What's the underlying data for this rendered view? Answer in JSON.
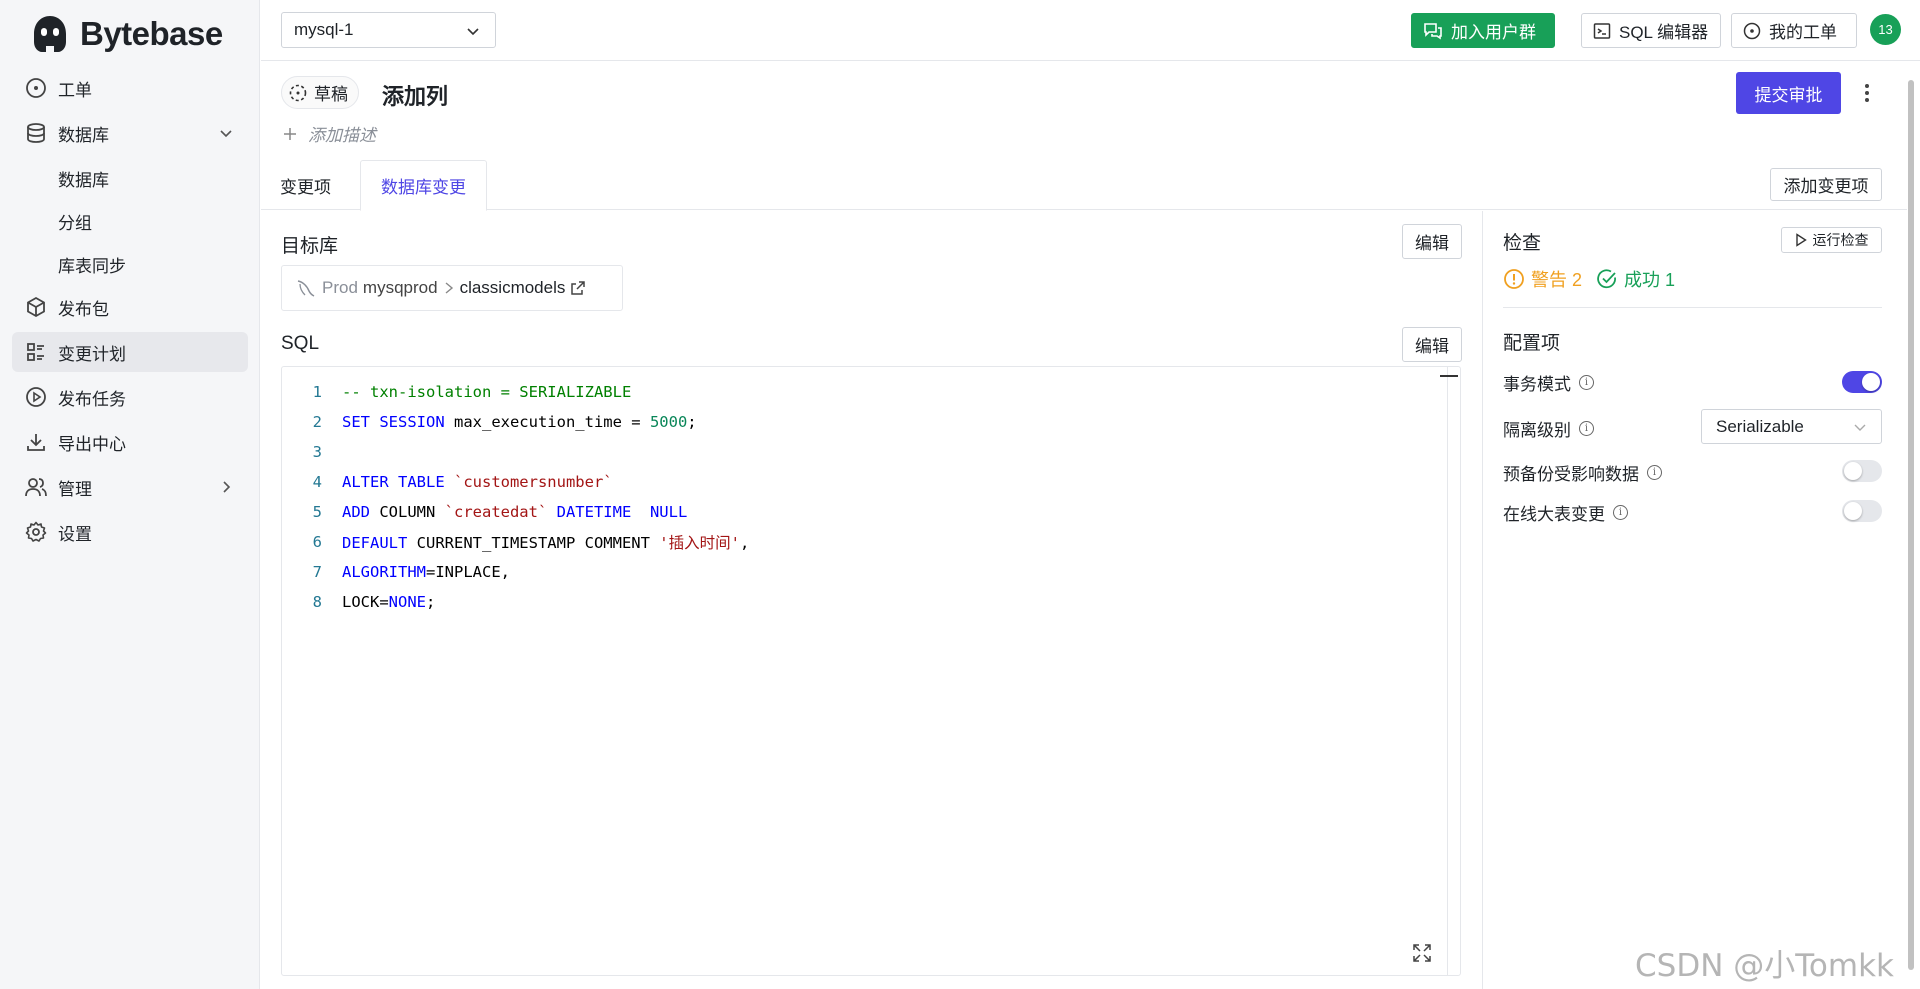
{
  "app": {
    "name": "Bytebase"
  },
  "sidebar": {
    "items": [
      {
        "label": "工单",
        "icon": "circle-dot-icon"
      },
      {
        "label": "数据库",
        "icon": "database-icon",
        "expanded": true,
        "children": [
          "数据库",
          "分组",
          "库表同步"
        ]
      },
      {
        "label": "发布包",
        "icon": "package-icon"
      },
      {
        "label": "变更计划",
        "icon": "list-layout-icon",
        "active": true
      },
      {
        "label": "发布任务",
        "icon": "play-circle-icon"
      },
      {
        "label": "导出中心",
        "icon": "download-icon"
      },
      {
        "label": "管理",
        "icon": "users-icon"
      },
      {
        "label": "设置",
        "icon": "gear-icon"
      }
    ]
  },
  "header": {
    "project_select": "mysql-1",
    "join_group": "加入用户群",
    "sql_editor": "SQL 编辑器",
    "my_issues": "我的工单",
    "avatar_count": "13"
  },
  "plan": {
    "status": "草稿",
    "title": "添加列",
    "add_description": "添加描述",
    "submit": "提交审批"
  },
  "tabs": {
    "items": [
      "变更项",
      "数据库变更"
    ],
    "active": "数据库变更",
    "add_change": "添加变更项"
  },
  "target": {
    "label": "目标库",
    "edit": "编辑",
    "env": "Prod",
    "instance": "mysqprod",
    "database": "classicmodels"
  },
  "sql": {
    "label": "SQL",
    "edit": "编辑",
    "lines": [
      "1",
      "2",
      "3",
      "4",
      "5",
      "6",
      "7",
      "8"
    ],
    "code": {
      "l1_comment": "-- txn-isolation = SERIALIZABLE",
      "l2_kw": "SET SESSION",
      "l2_txt": " max_execution_time = ",
      "l2_num": "5000",
      "l2_end": ";",
      "l4_kw": "ALTER TABLE",
      "l4_str": " `customersnumber`",
      "l5_kw": "ADD",
      "l5_txt": " COLUMN ",
      "l5_str": "`createdat`",
      "l5_kw2": " DATETIME  NULL",
      "l6_kw": "DEFAULT",
      "l6_txt": " CURRENT_TIMESTAMP COMMENT ",
      "l6_str": "'插入时间'",
      "l6_end": ",",
      "l7_kw": "ALGORITHM",
      "l7_txt": "=INPLACE,",
      "l8_txt": "LOCK=",
      "l8_kw": "NONE",
      "l8_end": ";"
    }
  },
  "checks": {
    "label": "检查",
    "run": "运行检查",
    "warning": "警告 2",
    "success": "成功 1"
  },
  "config": {
    "label": "配置项",
    "transaction_mode": "事务模式",
    "transaction_mode_on": true,
    "isolation_level": "隔离级别",
    "isolation_value": "Serializable",
    "backup_data": "预备份受影响数据",
    "backup_on": false,
    "online_migration": "在线大表变更",
    "online_on": false
  },
  "watermark": "CSDN @小Tomkk",
  "colors": {
    "primary": "#4f46e5",
    "success": "#18a058",
    "warning": "#f0a020"
  }
}
